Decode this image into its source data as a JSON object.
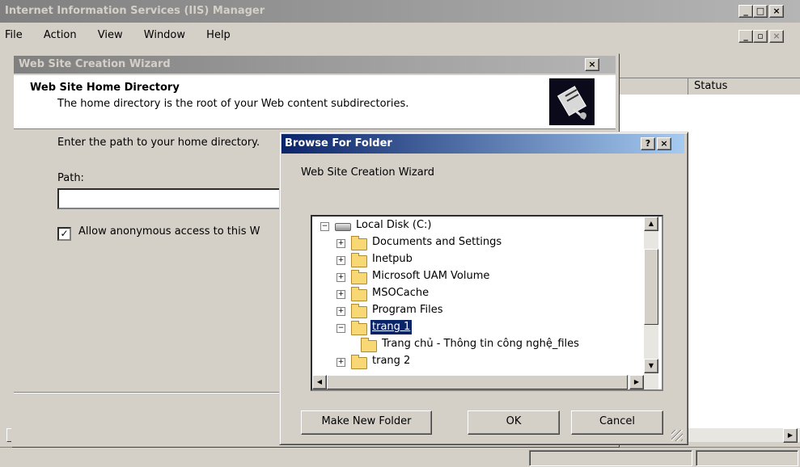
{
  "iis": {
    "title": "Internet Information Services (IIS) Manager",
    "menu": [
      "File",
      "Action",
      "View",
      "Window",
      "Help"
    ],
    "status_column": "Status"
  },
  "wizard": {
    "title": "Web Site Creation Wizard",
    "heading": "Web Site Home Directory",
    "subheading": "The home directory is the root of your Web content subdirectories.",
    "instruction": "Enter the path to your home directory.",
    "path_label": "Path:",
    "path_value": "",
    "anon_label": "Allow anonymous access to this W"
  },
  "browse": {
    "title": "Browse For Folder",
    "description": "Web Site Creation Wizard",
    "tree": [
      {
        "label": "Local Disk (C:)",
        "level": 0,
        "expander": "−",
        "icon": "drive-icon"
      },
      {
        "label": "Documents and Settings",
        "level": 1,
        "expander": "+",
        "icon": "folder-icon"
      },
      {
        "label": "Inetpub",
        "level": 1,
        "expander": "+",
        "icon": "folder-icon"
      },
      {
        "label": "Microsoft UAM Volume",
        "level": 1,
        "expander": "+",
        "icon": "folder-icon"
      },
      {
        "label": "MSOCache",
        "level": 1,
        "expander": "+",
        "icon": "folder-icon"
      },
      {
        "label": "Program Files",
        "level": 1,
        "expander": "+",
        "icon": "folder-icon"
      },
      {
        "label": "trang 1",
        "level": 1,
        "expander": "−",
        "icon": "folder-open-icon",
        "selected": true
      },
      {
        "label": "Trang chủ - Thông tin công nghệ_files",
        "level": 2,
        "expander": "",
        "icon": "folder-icon"
      },
      {
        "label": "trang 2",
        "level": 1,
        "expander": "+",
        "icon": "folder-icon"
      }
    ],
    "make_new_folder": "Make New Folder",
    "ok": "OK",
    "cancel": "Cancel",
    "help_button": "?",
    "close_button": "×"
  },
  "colors": {
    "active_title_start": "#0a246a",
    "active_title_end": "#a6caf0",
    "selection": "#0a246a",
    "face": "#d4d0c8"
  }
}
